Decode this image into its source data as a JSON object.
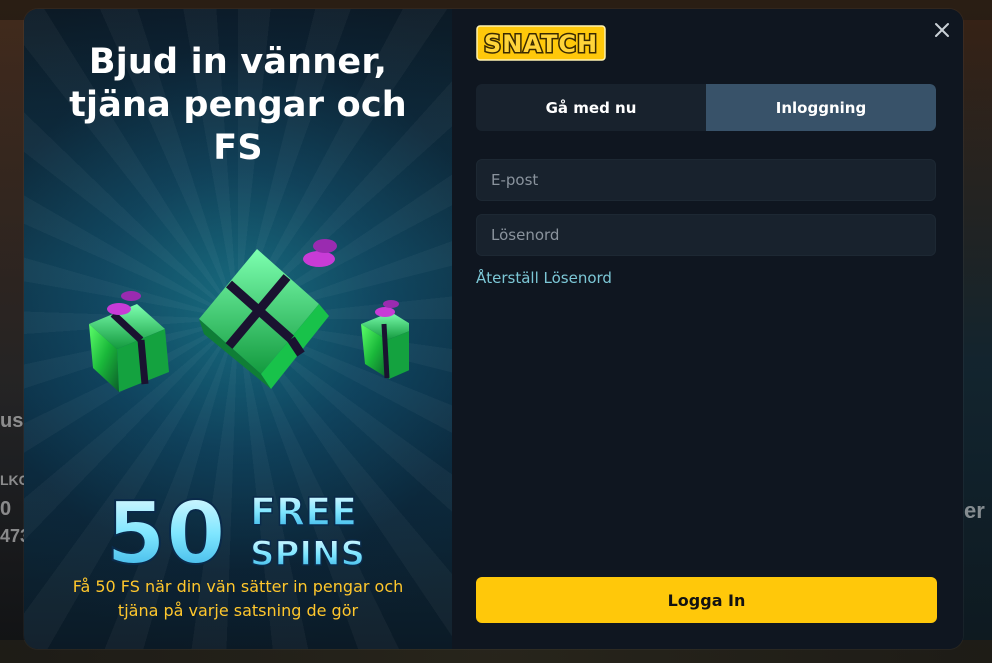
{
  "background": {
    "left_edge_text_1": "us",
    "left_edge_text_2": "LKC",
    "left_edge_text_3": "0",
    "left_edge_text_4": "473",
    "right_edge_text": "er"
  },
  "promo": {
    "title_line1": "Bjud in vänner,",
    "title_line2": "tjäna pengar och",
    "title_line3": "FS",
    "badge_number": "50",
    "badge_word1": "FREE",
    "badge_word2": "SPINS",
    "description_line1": "Få 50 FS när din vän sätter in pengar och",
    "description_line2": "tjäna på varje satsning de gör"
  },
  "panel": {
    "brand": "SNATCH",
    "tabs": [
      {
        "label": "Gå med nu",
        "active": false
      },
      {
        "label": "Inloggning",
        "active": true
      }
    ],
    "email": {
      "placeholder": "E-post",
      "value": ""
    },
    "password": {
      "placeholder": "Lösenord",
      "value": ""
    },
    "reset_link": "Återställ Lösenord",
    "login_button": "Logga In"
  },
  "colors": {
    "accent_yellow": "#ffc80a",
    "promo_text_yellow": "#ffc72c",
    "link_teal": "#7cc7d6",
    "tab_active": "#385269",
    "field_bg": "#18222d"
  }
}
